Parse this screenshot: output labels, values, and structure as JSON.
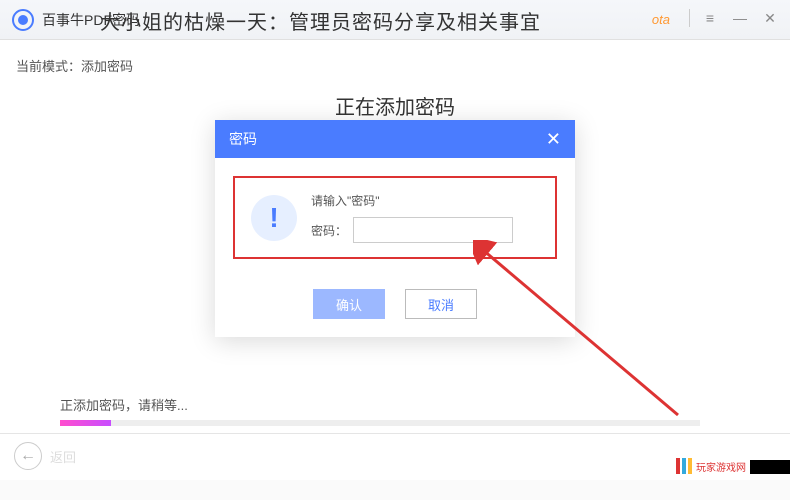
{
  "titlebar": {
    "app_name": "百事牛PDF密码",
    "overlay_heading": "大小姐的枯燥一天：管理员密码分享及相关事宜",
    "beta": "ota"
  },
  "mode": {
    "label": "当前模式：添加密码"
  },
  "main": {
    "title": "正在添加密码"
  },
  "dialog": {
    "title": "密码",
    "prompt": "请输入\"密码\"",
    "input_label": "密码：",
    "input_value": "",
    "confirm": "确认",
    "cancel": "取消"
  },
  "progress": {
    "label": "正添加密码，请稍等..."
  },
  "footer": {
    "back_label": "返回"
  },
  "watermark": {
    "text": "玩家游戏网"
  }
}
